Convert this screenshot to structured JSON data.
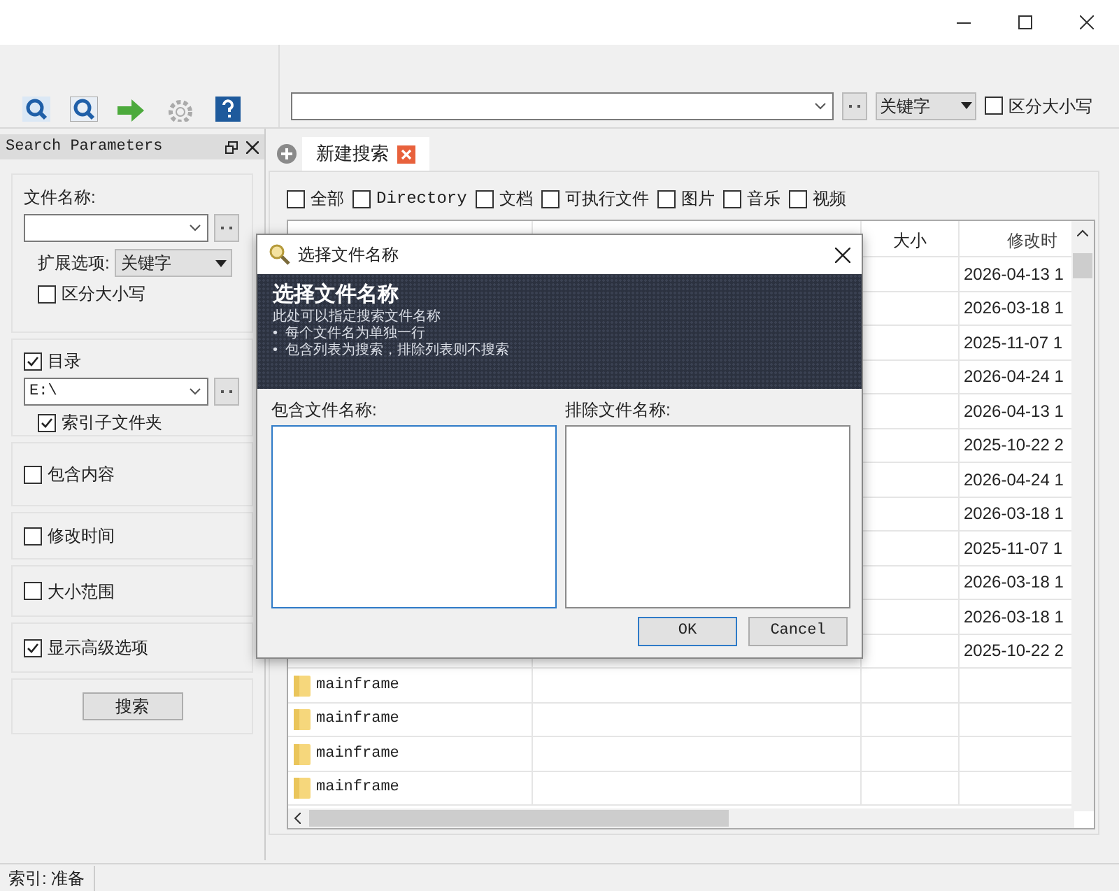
{
  "toolbar": {
    "match_mode": "关键字",
    "case_sensitive": {
      "label": "区分大小写",
      "checked": false
    }
  },
  "search_parameters": {
    "title": "Search Parameters",
    "file_name": {
      "label": "文件名称:",
      "extension_label": "扩展选项:",
      "extension_mode": "关键字",
      "case_sensitive": {
        "label": "区分大小写",
        "checked": false
      }
    },
    "directory": {
      "label": "目录",
      "checked": true,
      "value": "E:\\",
      "subfolders": {
        "label": "索引子文件夹",
        "checked": true
      }
    },
    "options": [
      {
        "label": "包含内容",
        "checked": false
      },
      {
        "label": "修改时间",
        "checked": false
      },
      {
        "label": "大小范围",
        "checked": false
      },
      {
        "label": "显示高级选项",
        "checked": true
      }
    ],
    "search_button": "搜索"
  },
  "tabs": [
    {
      "label": "新建搜索",
      "selected": true
    }
  ],
  "filters": [
    {
      "label": "全部",
      "checked": false,
      "mono": false
    },
    {
      "label": "Directory",
      "checked": false,
      "mono": true
    },
    {
      "label": "文档",
      "checked": false,
      "mono": false
    },
    {
      "label": "可执行文件",
      "checked": false,
      "mono": false
    },
    {
      "label": "图片",
      "checked": false,
      "mono": false
    },
    {
      "label": "音乐",
      "checked": false,
      "mono": false
    },
    {
      "label": "视频",
      "checked": false,
      "mono": false
    }
  ],
  "table": {
    "columns": [
      "大小",
      "修改时"
    ],
    "rows": [
      {
        "modified": "2026-04-13 1"
      },
      {
        "modified": "2026-03-18 1"
      },
      {
        "modified": "2025-11-07 1"
      },
      {
        "modified": "2026-04-24 1"
      },
      {
        "modified": "2026-04-13 1"
      },
      {
        "modified": "2025-10-22 2"
      },
      {
        "modified": "2026-04-24 1"
      },
      {
        "modified": "2026-03-18 1"
      },
      {
        "modified": "2025-11-07 1"
      },
      {
        "modified": "2026-03-18 1"
      },
      {
        "modified": "2026-03-18 1"
      },
      {
        "modified": "2025-10-22 2"
      },
      {
        "name": "mainframe"
      },
      {
        "name": "mainframe"
      },
      {
        "name": "mainframe"
      },
      {
        "name": "mainframe"
      }
    ]
  },
  "status_bar": "索引: 准备",
  "dialog": {
    "title": "选择文件名称",
    "banner_title": "选择文件名称",
    "banner_lines": [
      "此处可以指定搜索文件名称",
      "•  每个文件名为单独一行",
      "•  包含列表为搜索，排除列表则不搜索"
    ],
    "include_label": "包含文件名称:",
    "exclude_label": "排除文件名称:",
    "buttons": [
      "OK",
      "Cancel"
    ]
  }
}
